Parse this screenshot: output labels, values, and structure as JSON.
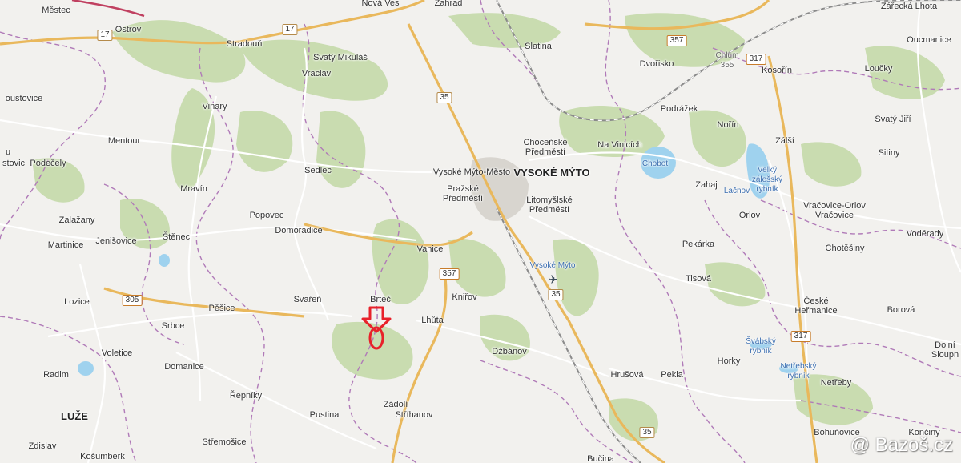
{
  "map": {
    "places": [
      {
        "id": "mestec",
        "text": "Městec"
      },
      {
        "id": "ostrov",
        "text": "Ostrov"
      },
      {
        "id": "nova-ves",
        "text": "Nová Ves"
      },
      {
        "id": "zahrad",
        "text": "Zahrad"
      },
      {
        "id": "zarecka",
        "text": "Zářecká Lhota"
      },
      {
        "id": "stradoun",
        "text": "Stradouň"
      },
      {
        "id": "slatina",
        "text": "Slatina"
      },
      {
        "id": "dvorisko",
        "text": "Dvořisko"
      },
      {
        "id": "oucmanice",
        "text": "Oucmanice"
      },
      {
        "id": "svaty-mikulas",
        "text": "Svatý Mikuláš"
      },
      {
        "id": "kosorin",
        "text": "Kosořín"
      },
      {
        "id": "loucky",
        "text": "Loučky"
      },
      {
        "id": "vraclav",
        "text": "Vraclav"
      },
      {
        "id": "oustovice",
        "text": "oustovice"
      },
      {
        "id": "vinary",
        "text": "Vinary"
      },
      {
        "id": "podrazek",
        "text": "Podrážek"
      },
      {
        "id": "norin",
        "text": "Nořín"
      },
      {
        "id": "svaty-jiri",
        "text": "Svatý Jiří"
      },
      {
        "id": "mentour",
        "text": "Mentour"
      },
      {
        "id": "chocenske",
        "text": "Choceňské\nPředměstí"
      },
      {
        "id": "na-vinicich",
        "text": "Na Vinicích"
      },
      {
        "id": "zalsi",
        "text": "Zálší"
      },
      {
        "id": "sitiny",
        "text": "Sitiny"
      },
      {
        "id": "u",
        "text": "u"
      },
      {
        "id": "stovic",
        "text": "stovic"
      },
      {
        "id": "podecely",
        "text": "Podečely"
      },
      {
        "id": "sedlec",
        "text": "Sedlec"
      },
      {
        "id": "vm-mesto",
        "text": "Vysoké Mýto-Město"
      },
      {
        "id": "vysoke-myto",
        "text": "VYSOKÉ MÝTO"
      },
      {
        "id": "prazske",
        "text": "Pražské\nPředměstí"
      },
      {
        "id": "litomyslske",
        "text": "Litomyšlské\nPředměstí"
      },
      {
        "id": "zahaj",
        "text": "Zahaj"
      },
      {
        "id": "mravin",
        "text": "Mravín"
      },
      {
        "id": "popovec",
        "text": "Popovec"
      },
      {
        "id": "vracovice",
        "text": "Vračovice-Orlov\nVračovice"
      },
      {
        "id": "orlov",
        "text": "Orlov"
      },
      {
        "id": "zalazany",
        "text": "Zalažany"
      },
      {
        "id": "domoradice",
        "text": "Domoradice"
      },
      {
        "id": "stenec",
        "text": "Štěnec"
      },
      {
        "id": "voderady",
        "text": "Voděrady"
      },
      {
        "id": "pekarka",
        "text": "Pekárka"
      },
      {
        "id": "martinice",
        "text": "Martinice"
      },
      {
        "id": "jenisovice",
        "text": "Jenišovice"
      },
      {
        "id": "vanice",
        "text": "Vanice"
      },
      {
        "id": "chotesiny",
        "text": "Chotěšiny"
      },
      {
        "id": "tisova",
        "text": "Tisová"
      },
      {
        "id": "lozice",
        "text": "Lozice"
      },
      {
        "id": "brtec",
        "text": "Brteč"
      },
      {
        "id": "svaren",
        "text": "Svařeň"
      },
      {
        "id": "knirov",
        "text": "Kniřov"
      },
      {
        "id": "pesice",
        "text": "Pěšice"
      },
      {
        "id": "ceske-hermanice",
        "text": "České\nHeřmanice"
      },
      {
        "id": "srbce",
        "text": "Srbce"
      },
      {
        "id": "luhta",
        "text": "Lhůta"
      },
      {
        "id": "borova",
        "text": "Borová"
      },
      {
        "id": "voletice",
        "text": "Voletice"
      },
      {
        "id": "dzbanov",
        "text": "Džbánov"
      },
      {
        "id": "dolni-sloupnice",
        "text": "Dolní\nSloupn"
      },
      {
        "id": "radim",
        "text": "Radim"
      },
      {
        "id": "domanice",
        "text": "Domanice"
      },
      {
        "id": "horky",
        "text": "Horky"
      },
      {
        "id": "hrusova",
        "text": "Hrušová"
      },
      {
        "id": "pekla",
        "text": "Pekla"
      },
      {
        "id": "netreby",
        "text": "Netřeby"
      },
      {
        "id": "repniky",
        "text": "Řepníky"
      },
      {
        "id": "zadoli",
        "text": "Zádolí"
      },
      {
        "id": "luze",
        "text": "LUŽE"
      },
      {
        "id": "pustina",
        "text": "Pustina"
      },
      {
        "id": "strihanov",
        "text": "Stříhanov"
      },
      {
        "id": "bohunovice",
        "text": "Bohuňovice"
      },
      {
        "id": "konciny",
        "text": "Končiny"
      },
      {
        "id": "stremosice",
        "text": "Střemošice"
      },
      {
        "id": "zdislav",
        "text": "Zdislav"
      },
      {
        "id": "kosumberk",
        "text": "Košumberk"
      },
      {
        "id": "bucina",
        "text": "Bučina"
      }
    ],
    "water_labels": [
      {
        "id": "chobot",
        "text": "Chobot"
      },
      {
        "id": "velky-zalessky",
        "text": "Velký\nzálešský\nrybník"
      },
      {
        "id": "lacnov",
        "text": "Lačnov"
      },
      {
        "id": "svabsky",
        "text": "Švábský\nrybník"
      },
      {
        "id": "netrebsky",
        "text": "Netřebský\nrybník"
      }
    ],
    "minor_labels": [
      {
        "id": "chlum",
        "text": "Chlum\n355"
      }
    ],
    "airport_label": "Vysoké Mýto",
    "road_numbers": [
      {
        "id": "r17a",
        "text": "17"
      },
      {
        "id": "r17b",
        "text": "17"
      },
      {
        "id": "r35a",
        "text": "35"
      },
      {
        "id": "r35b",
        "text": "35"
      },
      {
        "id": "r35c",
        "text": "35"
      },
      {
        "id": "r357a",
        "text": "357"
      },
      {
        "id": "r357b",
        "text": "357"
      },
      {
        "id": "r317a",
        "text": "317"
      },
      {
        "id": "r317b",
        "text": "317"
      },
      {
        "id": "r305",
        "text": "305"
      }
    ],
    "marker": {
      "color": "#e8212a",
      "icon": "location-pin-arrow-icon"
    },
    "watermark": "@ Bazoš.cz",
    "colors": {
      "background": "#f2f1ee",
      "forest": "#c9dcb0",
      "water": "#9fd2ee",
      "main_road": "#e9b85c",
      "rail": "#8a8a8a",
      "boundary": "#b07ab8"
    }
  }
}
